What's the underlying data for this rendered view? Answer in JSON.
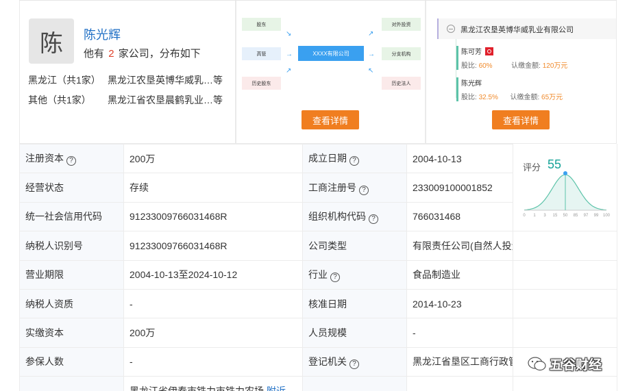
{
  "person": {
    "avatar_char": "陈",
    "name": "陈光辉",
    "summary_prefix": "他有",
    "company_count": "2",
    "summary_suffix": "家公司，分布如下",
    "regions": [
      {
        "region": "黑龙江（共1家）",
        "company": "黑龙江农垦英博华威乳…等"
      },
      {
        "region": "其他（共1家）",
        "company": "黑龙江省农垦晨鹤乳业…等"
      }
    ]
  },
  "structure": {
    "left": [
      "股东",
      "高管",
      "历史股东"
    ],
    "center": "XXXX有限公司",
    "right": [
      "对外投资",
      "分支机构",
      "历史法人"
    ],
    "button": "查看详情"
  },
  "shareholders": {
    "company": "黑龙江农垦英博华威乳业有限公司",
    "ratio_label": "股比:",
    "amount_label": "认缴金额:",
    "items": [
      {
        "name": "陈可芳",
        "ratio": "60%",
        "amount": "120万元"
      },
      {
        "name": "陈光辉",
        "ratio": "32.5%",
        "amount": "65万元"
      }
    ],
    "button": "查看详情"
  },
  "info": {
    "rows": [
      {
        "l1": "注册资本",
        "q1": true,
        "v1": "200万",
        "l2": "成立日期",
        "q2": true,
        "v2": "2004-10-13"
      },
      {
        "l1": "经营状态",
        "q1": false,
        "v1": "存续",
        "l2": "工商注册号",
        "q2": true,
        "v2": "233009100001852"
      },
      {
        "l1": "统一社会信用代码",
        "q1": false,
        "v1": "91233009766031468R",
        "l2": "组织机构代码",
        "q2": true,
        "v2": "766031468"
      },
      {
        "l1": "纳税人识别号",
        "q1": false,
        "v1": "91233009766031468R",
        "l2": "公司类型",
        "q2": false,
        "v2": "有限责任公司(自然人投资或控股)"
      },
      {
        "l1": "营业期限",
        "q1": false,
        "v1": "2004-10-13至2024-10-12",
        "l2": "行业",
        "q2": true,
        "v2": "食品制造业"
      },
      {
        "l1": "纳税人资质",
        "q1": false,
        "v1": "-",
        "l2": "核准日期",
        "q2": false,
        "v2": "2014-10-23"
      },
      {
        "l1": "实缴资本",
        "q1": false,
        "v1": "200万",
        "l2": "人员规模",
        "q2": false,
        "v2": "-"
      },
      {
        "l1": "参保人数",
        "q1": false,
        "v1": "-",
        "l2": "登记机关",
        "q2": true,
        "v2": "黑龙江省垦区工商行政管理局红兴"
      },
      {
        "l1": "",
        "q1": false,
        "v1": "黑龙江省伊春市铁力市铁力农场",
        "l2": "",
        "q2": false,
        "v2": ""
      }
    ],
    "address_link": "附近",
    "help_glyph": "?"
  },
  "score": {
    "label": "评分",
    "value": 55,
    "ticks": [
      "0",
      "1",
      "3",
      "15",
      "50",
      "85",
      "97",
      "99",
      "100"
    ]
  },
  "watermark": "五谷财经",
  "colors": {
    "accent_orange": "#f07e20",
    "link_blue": "#1f6fc5",
    "teal": "#17a398",
    "red": "#e0412b"
  }
}
